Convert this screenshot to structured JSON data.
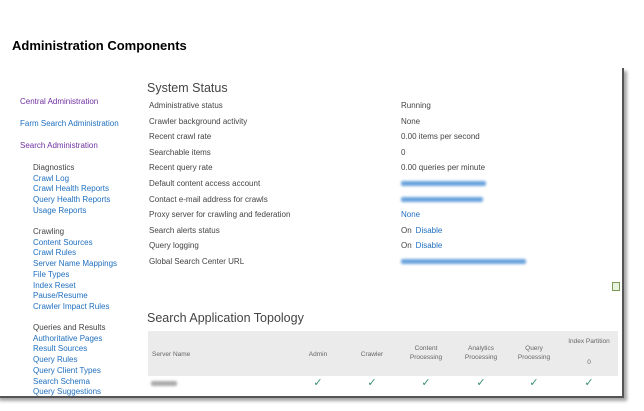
{
  "title": "Administration Components",
  "sidebar": {
    "top": [
      {
        "label": "Central Administration"
      },
      {
        "label": "Farm Search Administration"
      },
      {
        "label": "Search Administration"
      }
    ],
    "groups": [
      {
        "heading": "Diagnostics",
        "items": [
          "Crawl Log",
          "Crawl Health Reports",
          "Query Health Reports",
          "Usage Reports"
        ]
      },
      {
        "heading": "Crawling",
        "items": [
          "Content Sources",
          "Crawl Rules",
          "Server Name Mappings",
          "File Types",
          "Index Reset",
          "Pause/Resume",
          "Crawler Impact Rules"
        ]
      },
      {
        "heading": "Queries and Results",
        "items": [
          "Authoritative Pages",
          "Result Sources",
          "Query Rules",
          "Query Client Types",
          "Search Schema",
          "Query Suggestions"
        ]
      }
    ]
  },
  "system_status": {
    "heading": "System Status",
    "rows": [
      {
        "label": "Administrative status",
        "value": "Running"
      },
      {
        "label": "Crawler background activity",
        "value": "None"
      },
      {
        "label": "Recent crawl rate",
        "value": "0.00 items per second"
      },
      {
        "label": "Searchable items",
        "value": "0"
      },
      {
        "label": "Recent query rate",
        "value": "0.00 queries per minute"
      },
      {
        "label": "Default content access account",
        "value": ""
      },
      {
        "label": "Contact e-mail address for crawls",
        "value": ""
      },
      {
        "label": "Proxy server for crawling and federation",
        "value": "None",
        "link": true
      },
      {
        "label": "Search alerts status",
        "value": "On",
        "action": "Disable"
      },
      {
        "label": "Query logging",
        "value": "On",
        "action": "Disable"
      },
      {
        "label": "Global Search Center URL",
        "value": ""
      }
    ],
    "export_icon": "spreadsheet-icon"
  },
  "topology": {
    "heading": "Search Application Topology",
    "columns": [
      "Server Name",
      "Admin",
      "Crawler",
      "Content Processing",
      "Analytics Processing",
      "Query Processing",
      "Index Partition"
    ],
    "index_partition_number": "0",
    "rows": [
      {
        "server": "",
        "checks": [
          true,
          true,
          true,
          true,
          true,
          true
        ]
      }
    ],
    "check_color": "#3a9070"
  }
}
